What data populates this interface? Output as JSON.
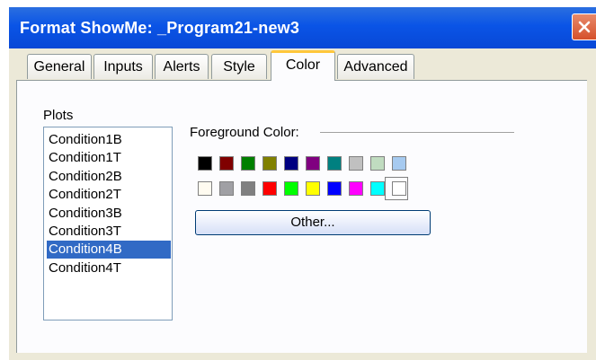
{
  "window": {
    "title": "Format ShowMe: _Program21-new3",
    "close_icon": "close-icon"
  },
  "tabs": [
    {
      "label": "General",
      "active": false
    },
    {
      "label": "Inputs",
      "active": false
    },
    {
      "label": "Alerts",
      "active": false
    },
    {
      "label": "Style",
      "active": false
    },
    {
      "label": "Color",
      "active": true
    },
    {
      "label": "Advanced",
      "active": false
    }
  ],
  "plots": {
    "label": "Plots",
    "items": [
      "Condition1B",
      "Condition1T",
      "Condition2B",
      "Condition2T",
      "Condition3B",
      "Condition3T",
      "Condition4B",
      "Condition4T"
    ],
    "selected": "Condition4B"
  },
  "foreground": {
    "label": "Foreground Color:",
    "row1": [
      "#000000",
      "#800000",
      "#008000",
      "#808000",
      "#000080",
      "#800080",
      "#008080",
      "#c0c0c0",
      "#c0dcc0",
      "#a6caf0"
    ],
    "row2": [
      "#fffbf0",
      "#a0a0a4",
      "#808080",
      "#ff0000",
      "#00ff00",
      "#ffff00",
      "#0000ff",
      "#ff00ff",
      "#00ffff",
      "#ffffff"
    ],
    "selected_color": "#00ffff",
    "other_button": "Other..."
  }
}
